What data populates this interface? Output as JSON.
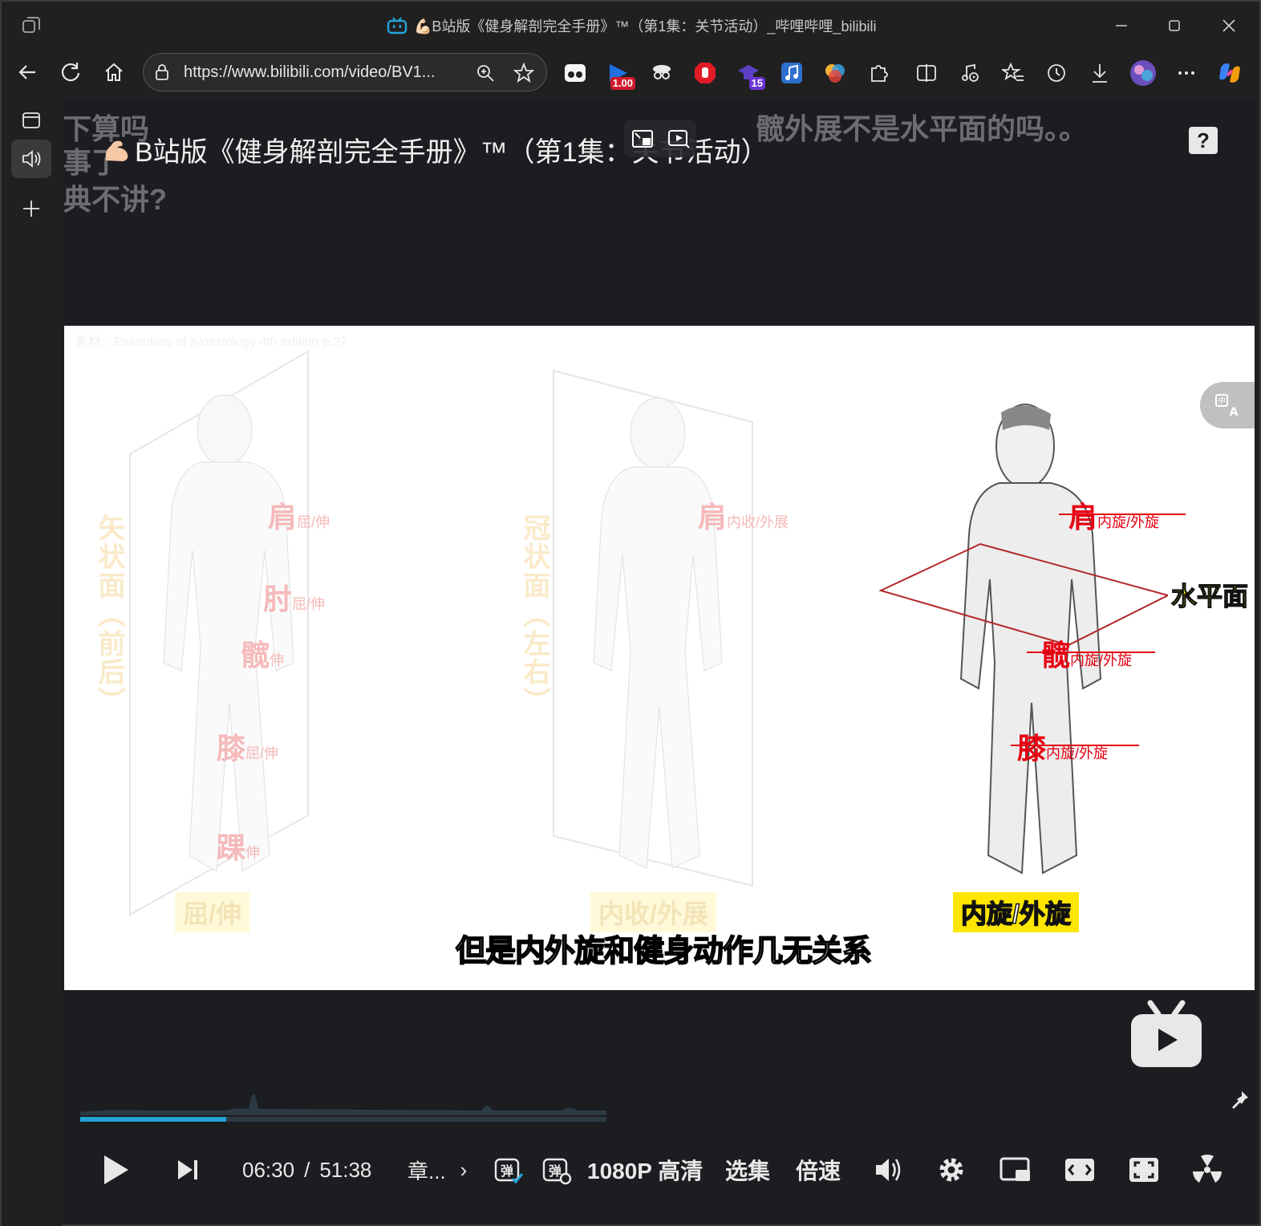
{
  "window": {
    "title": "💪🏻B站版《健身解剖完全手册》™（第1集：关节活动）_哔哩哔哩_bilibili"
  },
  "toolbar": {
    "url": "https://www.bilibili.com/video/BV1...",
    "extensions": [
      {
        "icon": "glasses-extension-icon"
      },
      {
        "icon": "speed-extension-icon",
        "badge": "1.00"
      },
      {
        "icon": "spy-extension-icon"
      },
      {
        "icon": "stop-hand-extension-icon"
      },
      {
        "icon": "graduation-cap-extension-icon",
        "badge": "15"
      },
      {
        "icon": "music-note-extension-icon"
      },
      {
        "icon": "colorful-extension-icon"
      }
    ]
  },
  "page": {
    "video_title": "B站版《健身解剖完全手册》™（第1集：关节活动）",
    "danmaku": [
      "下算吗",
      "事了",
      "典不讲?",
      "髋外展不是水平面的吗。。"
    ],
    "help_label": "?"
  },
  "video": {
    "source_note": "素材：Essentials of Kinesiology 4th edition p.27",
    "planes": [
      {
        "vertical_label": "矢状面（前后）",
        "caption": "屈/伸",
        "joints": [
          {
            "name": "肩",
            "motion": "屈/伸"
          },
          {
            "name": "肘",
            "motion": "屈/伸"
          },
          {
            "name": "髋",
            "motion": "伸"
          },
          {
            "name": "膝",
            "motion": "屈/伸"
          },
          {
            "name": "踝",
            "motion": "伸"
          }
        ]
      },
      {
        "vertical_label": "冠状面（左右）",
        "caption": "内收/外展",
        "joints": [
          {
            "name": "肩",
            "motion": "内收/外展"
          }
        ]
      },
      {
        "plane_label": "水平面",
        "caption": "内旋/外旋",
        "joints": [
          {
            "name": "肩",
            "motion": "内旋/外旋"
          },
          {
            "name": "髋",
            "motion": "内旋/外旋"
          },
          {
            "name": "膝",
            "motion": "内旋/外旋"
          }
        ]
      }
    ],
    "subtitle": "但是内外旋和健身动作几无关系",
    "progress_fraction": 0.126
  },
  "controls": {
    "current_time": "06:30",
    "separator": "/",
    "duration": "51:38",
    "chapter": "章...",
    "chapter_arrow": "›",
    "quality": "1080P 高清",
    "episodes": "选集",
    "speed": "倍速"
  },
  "colors": {
    "accent_blue": "#23a3d7",
    "joint_red": "#e60012",
    "caption_yellow": "#ffe600"
  }
}
